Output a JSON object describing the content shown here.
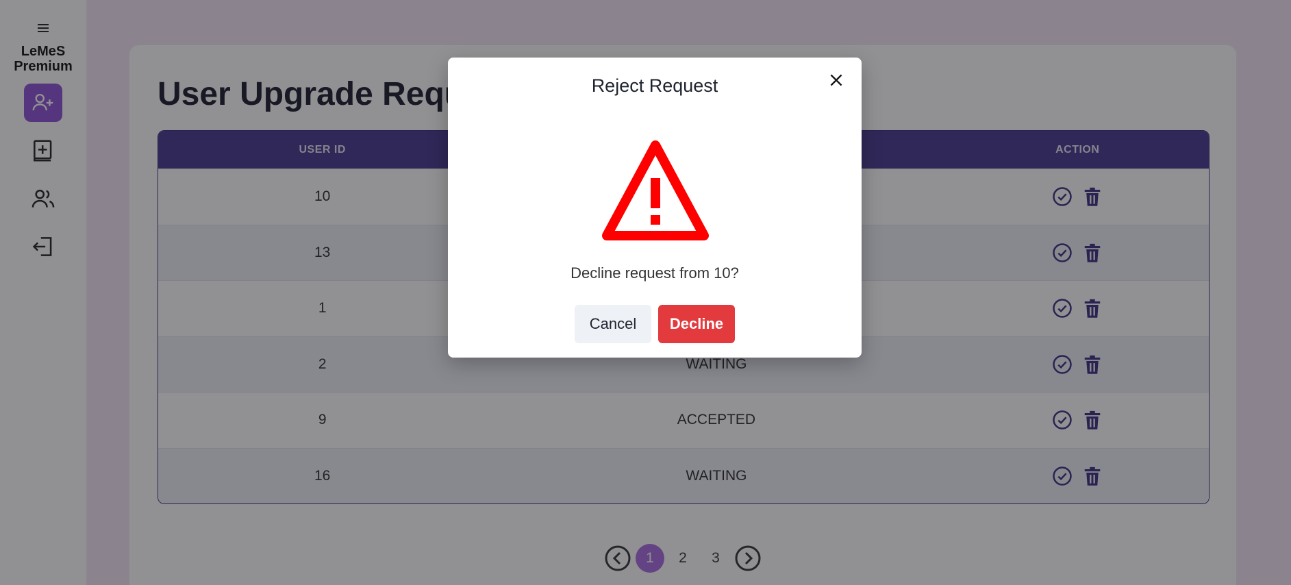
{
  "sidebar": {
    "menu_icon": "hamburger-icon",
    "brand": "LeMeS Premium",
    "items": [
      {
        "icon": "user-plus-icon",
        "active": true
      },
      {
        "icon": "book-add-icon",
        "active": false
      },
      {
        "icon": "users-icon",
        "active": false
      },
      {
        "icon": "logout-icon",
        "active": false
      }
    ]
  },
  "main": {
    "title": "User Upgrade Requ",
    "table": {
      "headers": [
        "USER ID",
        "",
        "ACTION"
      ],
      "rows": [
        {
          "user_id": "10",
          "status": ""
        },
        {
          "user_id": "13",
          "status": ""
        },
        {
          "user_id": "1",
          "status": ""
        },
        {
          "user_id": "2",
          "status": "WAITING"
        },
        {
          "user_id": "9",
          "status": "ACCEPTED"
        },
        {
          "user_id": "16",
          "status": "WAITING"
        }
      ]
    },
    "pagination": {
      "pages": [
        "1",
        "2",
        "3"
      ],
      "current": "1"
    }
  },
  "modal": {
    "title": "Reject Request",
    "message": "Decline request from 10?",
    "cancel_label": "Cancel",
    "decline_label": "Decline",
    "icon": "warning-triangle-icon"
  },
  "colors": {
    "accent": "#8c52d6",
    "table_header": "#45368f",
    "warning": "#ff0000",
    "decline": "#e23a3d"
  }
}
